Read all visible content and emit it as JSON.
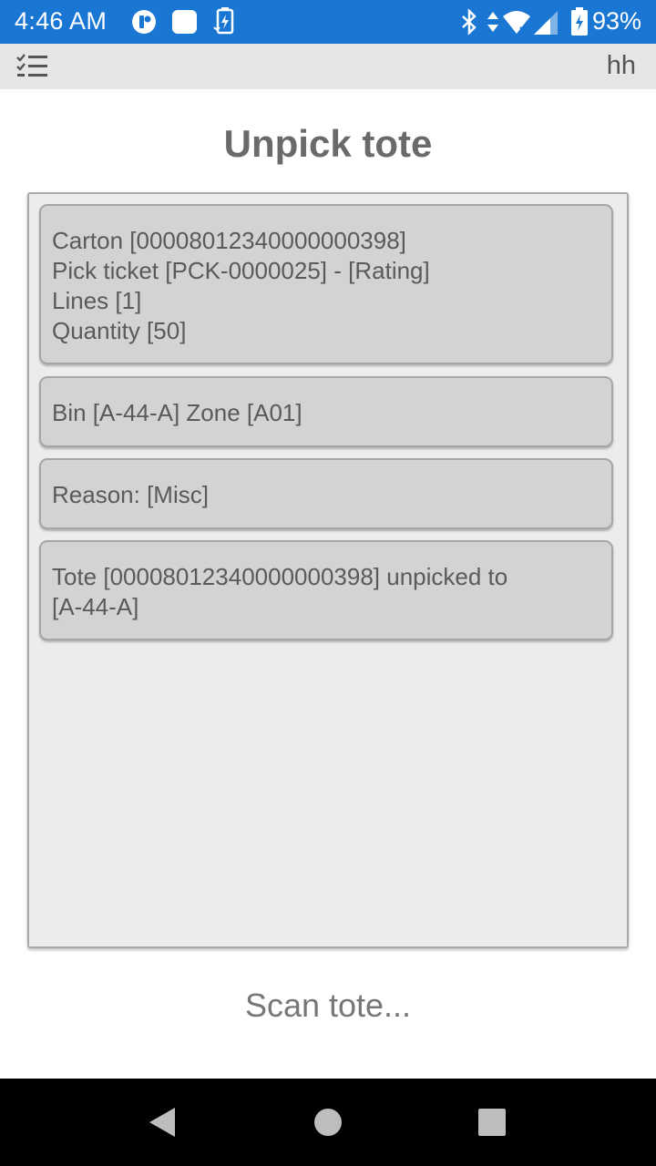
{
  "status_bar": {
    "time": "4:46 AM",
    "battery_percent": "93%",
    "icons": [
      "app-notification-icon",
      "square-notification-icon",
      "battery-saver-icon",
      "bluetooth-icon",
      "data-arrows-icon",
      "wifi-icon",
      "signal-icon",
      "battery-charging-icon"
    ]
  },
  "app_bar": {
    "menu_icon": "checklist-menu-icon",
    "user": "hh"
  },
  "page": {
    "title": "Unpick tote"
  },
  "log": {
    "cards": [
      {
        "lines": [
          "Carton [00008012340000000398]",
          "Pick ticket [PCK-0000025] - [Rating]",
          "Lines [1]",
          "Quantity [50]"
        ]
      },
      {
        "lines": [
          "Bin [A-44-A] Zone [A01]"
        ]
      },
      {
        "lines": [
          "Reason: [Misc]"
        ]
      },
      {
        "lines": [
          "Tote [00008012340000000398] unpicked to",
          "[A-44-A]"
        ]
      }
    ]
  },
  "scan": {
    "prompt": "Scan tote..."
  },
  "colors": {
    "status_bar": "#1976d2",
    "app_bar": "#e6e6e6",
    "card": "#d3d3d3",
    "panel": "#ececec"
  }
}
